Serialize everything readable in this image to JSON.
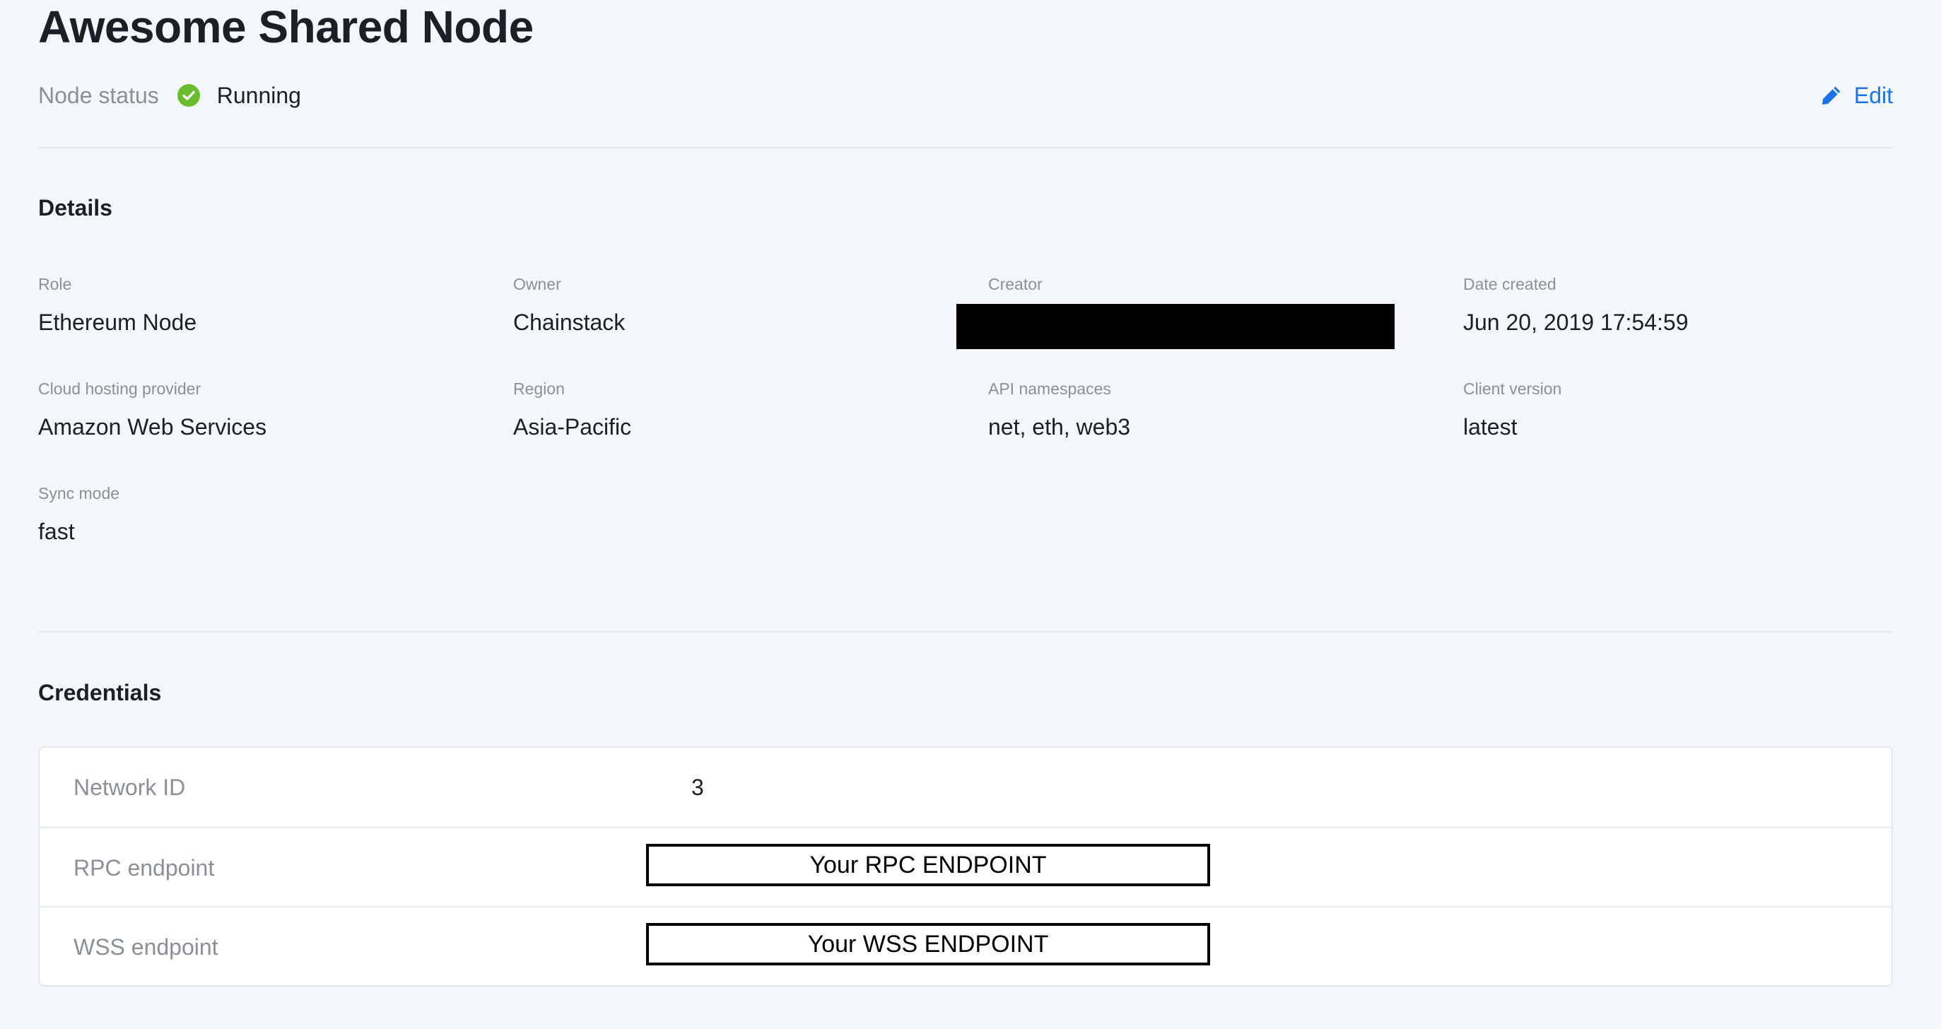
{
  "header": {
    "title": "Awesome Shared Node",
    "status_label": "Node status",
    "status_value": "Running",
    "status_color": "#6cbd2e",
    "edit_label": "Edit",
    "accent_color": "#1a73e8"
  },
  "details": {
    "section_title": "Details",
    "fields": [
      {
        "label": "Role",
        "value": "Ethereum Node"
      },
      {
        "label": "Owner",
        "value": "Chainstack"
      },
      {
        "label": "Creator",
        "value": "",
        "redacted": true
      },
      {
        "label": "Date created",
        "value": "Jun 20, 2019 17:54:59"
      },
      {
        "label": "Cloud hosting provider",
        "value": "Amazon Web Services"
      },
      {
        "label": "Region",
        "value": "Asia-Pacific"
      },
      {
        "label": "API namespaces",
        "value": "net, eth, web3"
      },
      {
        "label": "Client version",
        "value": "latest"
      },
      {
        "label": "Sync mode",
        "value": "fast"
      }
    ]
  },
  "credentials": {
    "section_title": "Credentials",
    "rows": [
      {
        "label": "Network ID",
        "value": "3"
      },
      {
        "label": "RPC endpoint",
        "value": "Your RPC ENDPOINT"
      },
      {
        "label": "WSS endpoint",
        "value": "Your WSS ENDPOINT"
      }
    ]
  },
  "icons": {
    "status": "check-circle-icon",
    "edit": "pencil-icon"
  }
}
